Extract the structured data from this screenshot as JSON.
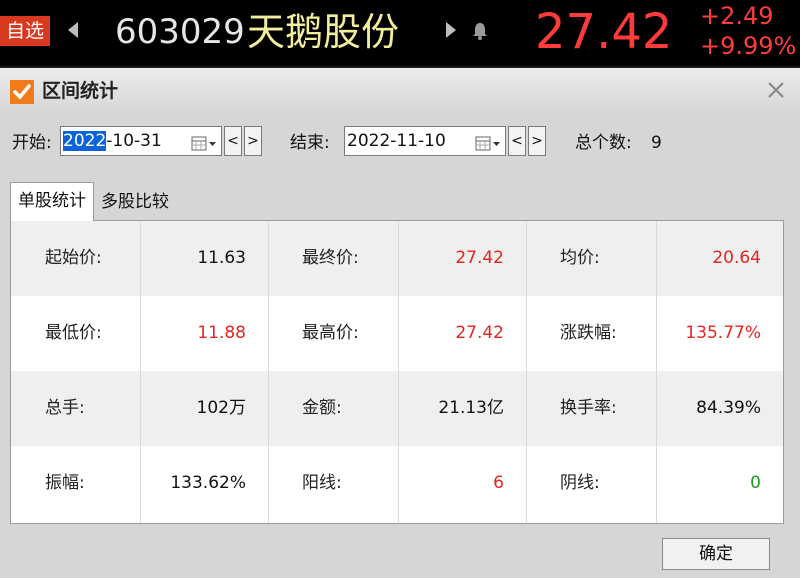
{
  "quote": {
    "watch_label": "自选",
    "code": "603029",
    "name": "天鹅股份",
    "price": "27.42",
    "change": "+2.49",
    "change_pct": "+9.99%"
  },
  "dialog": {
    "title": "区间统计",
    "start_label": "开始:",
    "start_year": "2022",
    "start_rest": "-10-31",
    "end_label": "结束:",
    "end_date": "2022-11-10",
    "prev_label": "<",
    "next_label": ">",
    "count_label": "总个数:",
    "count_value": "9",
    "tabs": [
      "单股统计",
      "多股比较"
    ],
    "ok_label": "确定"
  },
  "stats": [
    [
      {
        "label": "起始价:",
        "value": "11.63",
        "color": "black"
      },
      {
        "label": "最终价:",
        "value": "27.42",
        "color": "red"
      },
      {
        "label": "均价:",
        "value": "20.64",
        "color": "red"
      }
    ],
    [
      {
        "label": "最低价:",
        "value": "11.88",
        "color": "red"
      },
      {
        "label": "最高价:",
        "value": "27.42",
        "color": "red"
      },
      {
        "label": "涨跌幅:",
        "value": "135.77%",
        "color": "red"
      }
    ],
    [
      {
        "label": "总手:",
        "value": "102万",
        "color": "black"
      },
      {
        "label": "金额:",
        "value": "21.13亿",
        "color": "black"
      },
      {
        "label": "换手率:",
        "value": "84.39%",
        "color": "black"
      }
    ],
    [
      {
        "label": "振幅:",
        "value": "133.62%",
        "color": "black"
      },
      {
        "label": "阳线:",
        "value": "6",
        "color": "red"
      },
      {
        "label": "阴线:",
        "value": "0",
        "color": "green"
      }
    ]
  ]
}
